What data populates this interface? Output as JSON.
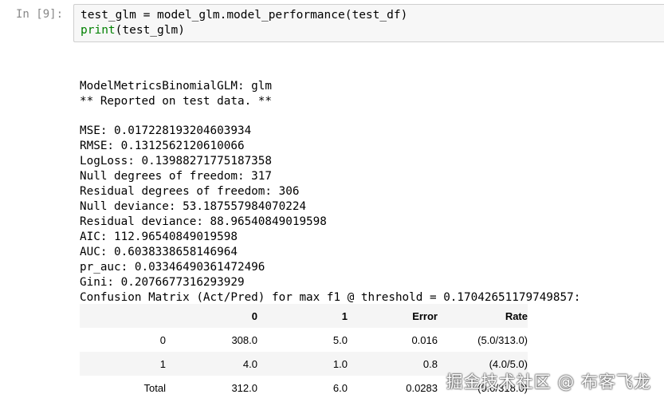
{
  "cell": {
    "prompt": "In [9]:",
    "code_line_1": "test_glm = model_glm.model_performance(test_df)",
    "code_line_2_kw": "print",
    "code_line_2_rest": "(test_glm)"
  },
  "output": {
    "lines": [
      "ModelMetricsBinomialGLM: glm",
      "** Reported on test data. **",
      "",
      "MSE: 0.017228193204603934",
      "RMSE: 0.1312562120610066",
      "LogLoss: 0.13988271775187358",
      "Null degrees of freedom: 317",
      "Residual degrees of freedom: 306",
      "Null deviance: 53.187557984070224",
      "Residual deviance: 88.96540849019598",
      "AIC: 112.96540849019598",
      "AUC: 0.6038338658146964",
      "pr_auc: 0.03346490361472496",
      "Gini: 0.2076677316293929",
      "Confusion Matrix (Act/Pred) for max f1 @ threshold = 0.17042651179749857:"
    ]
  },
  "confusion_matrix": {
    "headers": [
      "",
      "0",
      "1",
      "Error",
      "Rate"
    ],
    "rows": [
      [
        "0",
        "308.0",
        "5.0",
        "0.016",
        "(5.0/313.0)"
      ],
      [
        "1",
        "4.0",
        "1.0",
        "0.8",
        "(4.0/5.0)"
      ],
      [
        "Total",
        "312.0",
        "6.0",
        "0.0283",
        "(9.0/318.0)"
      ]
    ]
  },
  "watermark": "掘金技术社区 @ 布客飞龙"
}
